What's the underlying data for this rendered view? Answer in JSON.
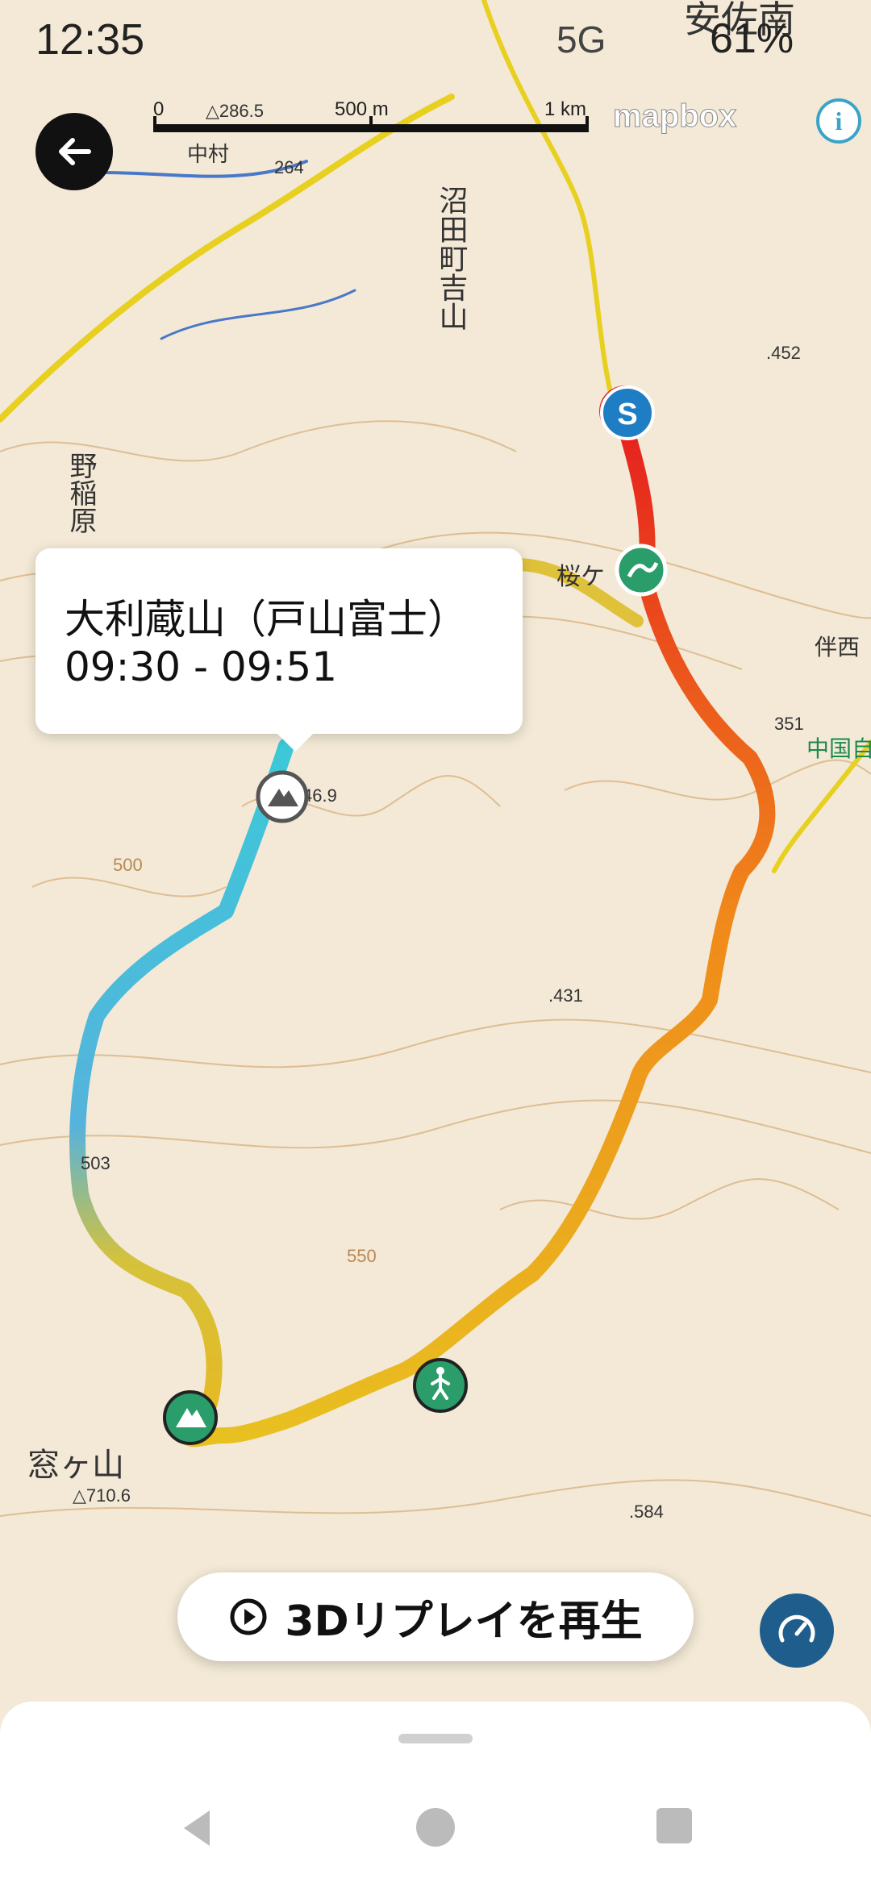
{
  "status_bar": {
    "time": "12:35",
    "network": "5G",
    "battery": "61%"
  },
  "scale_bar": {
    "zero": "0",
    "mid": "500 m",
    "end": "1 km"
  },
  "attribution": {
    "logo": "mapbox",
    "info_icon": "info-icon"
  },
  "callout": {
    "name": "大利蔵山（戸山富士）",
    "time_range": "09:30 - 09:51"
  },
  "map_labels": {
    "town": "沼田町吉山",
    "village": "野稲原",
    "place_sakura": "桜ケ",
    "mountain": "窓ヶ山",
    "elev_452": ".452",
    "elev_351": "351",
    "elev_431": ".431",
    "elev_584": ".584",
    "elev_503": "503",
    "elev_550": "550",
    "elev_500": "500",
    "elev_264": "264",
    "elev_2865": "△286.5",
    "elev_7106": "△710.6",
    "elev_469": "46.9",
    "top_right": "安佐南",
    "highway": "中国自",
    "place_right": "伴西",
    "place_nakamura": "中村"
  },
  "markers": {
    "start": "S",
    "start_color": "#1f7dc4",
    "peak_color": "#2a9d6a"
  },
  "replay_button": {
    "label": "3Dリプレイを再生",
    "icon": "play-circle-icon"
  },
  "speed_button": {
    "icon": "speedometer-icon"
  },
  "nav_bar": {
    "back": "nav-back-icon",
    "home": "nav-home-icon",
    "recents": "nav-recents-icon"
  }
}
